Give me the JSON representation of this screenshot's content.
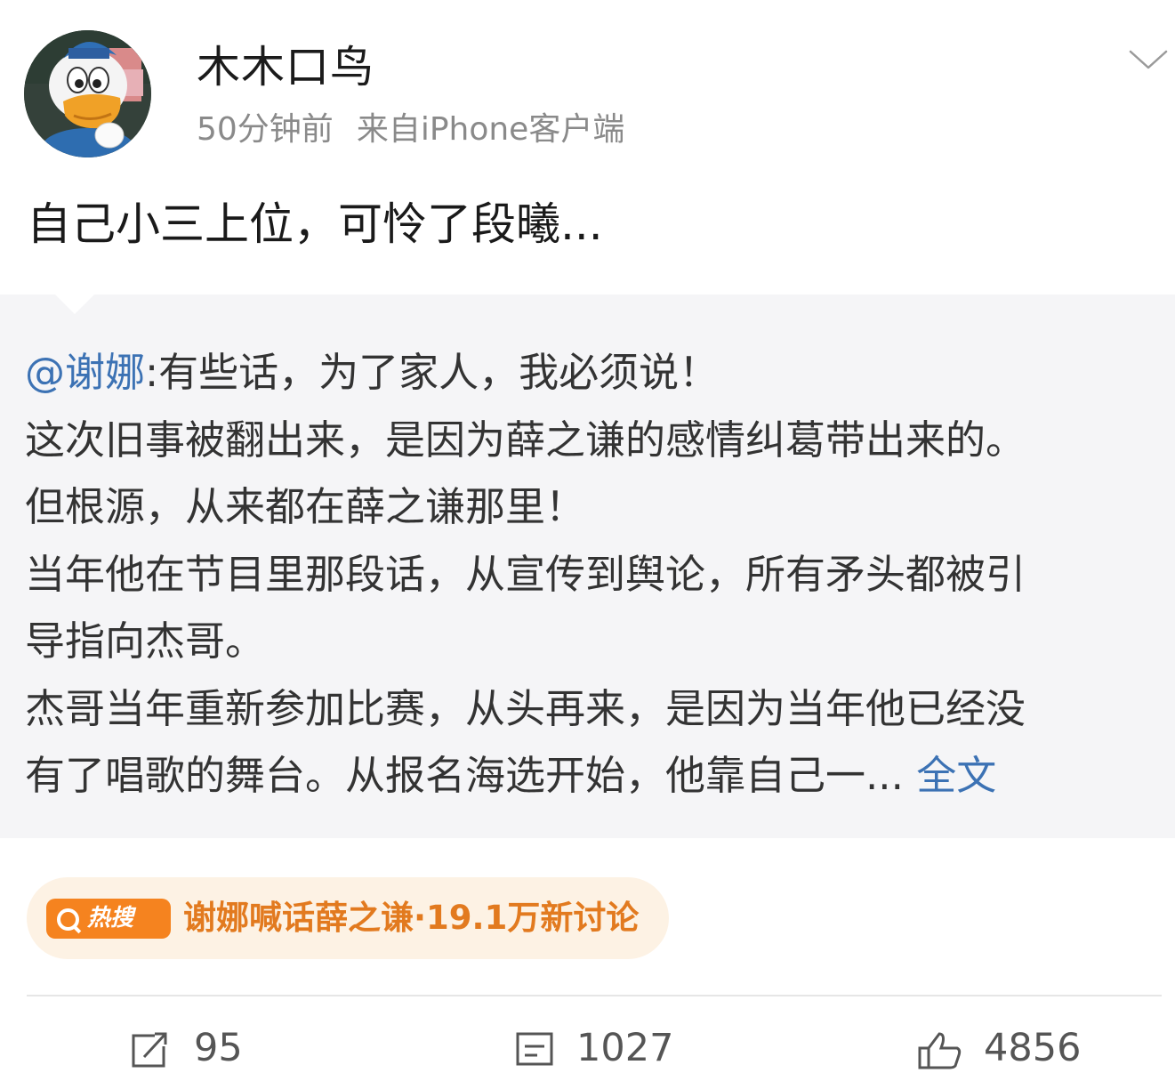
{
  "post": {
    "author": "木木口鸟",
    "time": "50分钟前",
    "source": "来自iPhone客户端",
    "text": "自己小三上位，可怜了段曦...",
    "avatar_icon": "donald-duck-avatar",
    "menu_icon": "chevron-down-icon"
  },
  "repost": {
    "mention": "@谢娜",
    "lines": [
      ":有些话，为了家人，我必须说！",
      "这次旧事被翻出来，是因为薛之谦的感情纠葛带出来的。",
      "但根源，从来都在薛之谦那里！",
      "当年他在节目里那段话，从宣传到舆论，所有矛头都被引",
      "导指向杰哥。",
      "杰哥当年重新参加比赛，从头再来，是因为当年他已经没",
      "有了唱歌的舞台。从报名海选开始，他靠自己一..."
    ],
    "more_link": "全文"
  },
  "hot_search": {
    "badge": "热搜",
    "text": "谢娜喊话薛之谦·19.1万新讨论",
    "accent": "#f5831f",
    "text_color": "#e27a1f",
    "background": "#fdf2e4"
  },
  "actions": {
    "repost_count": "95",
    "comment_count": "1027",
    "like_count": "4856"
  },
  "colors": {
    "link": "#3c72b4",
    "repost_bg": "#f5f5f7"
  }
}
